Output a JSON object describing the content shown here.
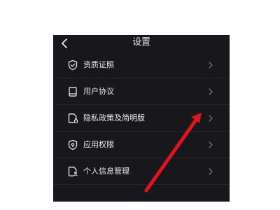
{
  "header": {
    "title": "设置",
    "back_icon": "chevron-left-icon"
  },
  "settings": {
    "items": [
      {
        "label": "资质证照",
        "icon": "shield-check-icon"
      },
      {
        "label": "用户协议",
        "icon": "book-icon"
      },
      {
        "label": "隐私政策及简明版",
        "icon": "document-lock-icon"
      },
      {
        "label": "应用权限",
        "icon": "shield-lock-icon"
      },
      {
        "label": "个人信息管理",
        "icon": "document-user-icon"
      }
    ]
  },
  "annotation": {
    "type": "red-arrow",
    "color": "#e0141e",
    "points_to": "隐私政策及简明版"
  },
  "colors": {
    "background": "#17171c",
    "text": "#e8e8ec",
    "chevron": "#6d6d76",
    "divider": "#24242b"
  }
}
